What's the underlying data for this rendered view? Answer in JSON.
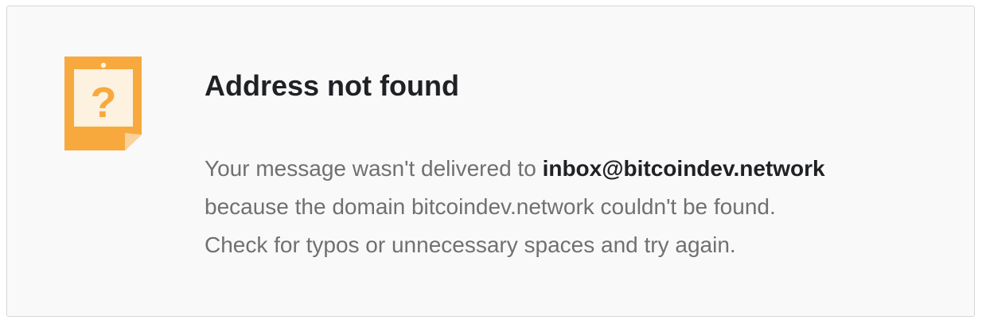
{
  "dialog": {
    "icon": "question-note-icon",
    "title": "Address not found",
    "message": {
      "line1_prefix": "Your message wasn't delivered to ",
      "address": "inbox@bitcoindev.network",
      "line2": "because the domain bitcoindev.network couldn't be found.",
      "line3": "Check for typos or unnecessary spaces and try again."
    }
  },
  "colors": {
    "card_background": "#f9f9f9",
    "card_border": "#d6d6d6",
    "icon_orange": "#f7a93e",
    "icon_paper": "#fdf1e0",
    "title_text": "#202124",
    "body_text": "#707070"
  }
}
